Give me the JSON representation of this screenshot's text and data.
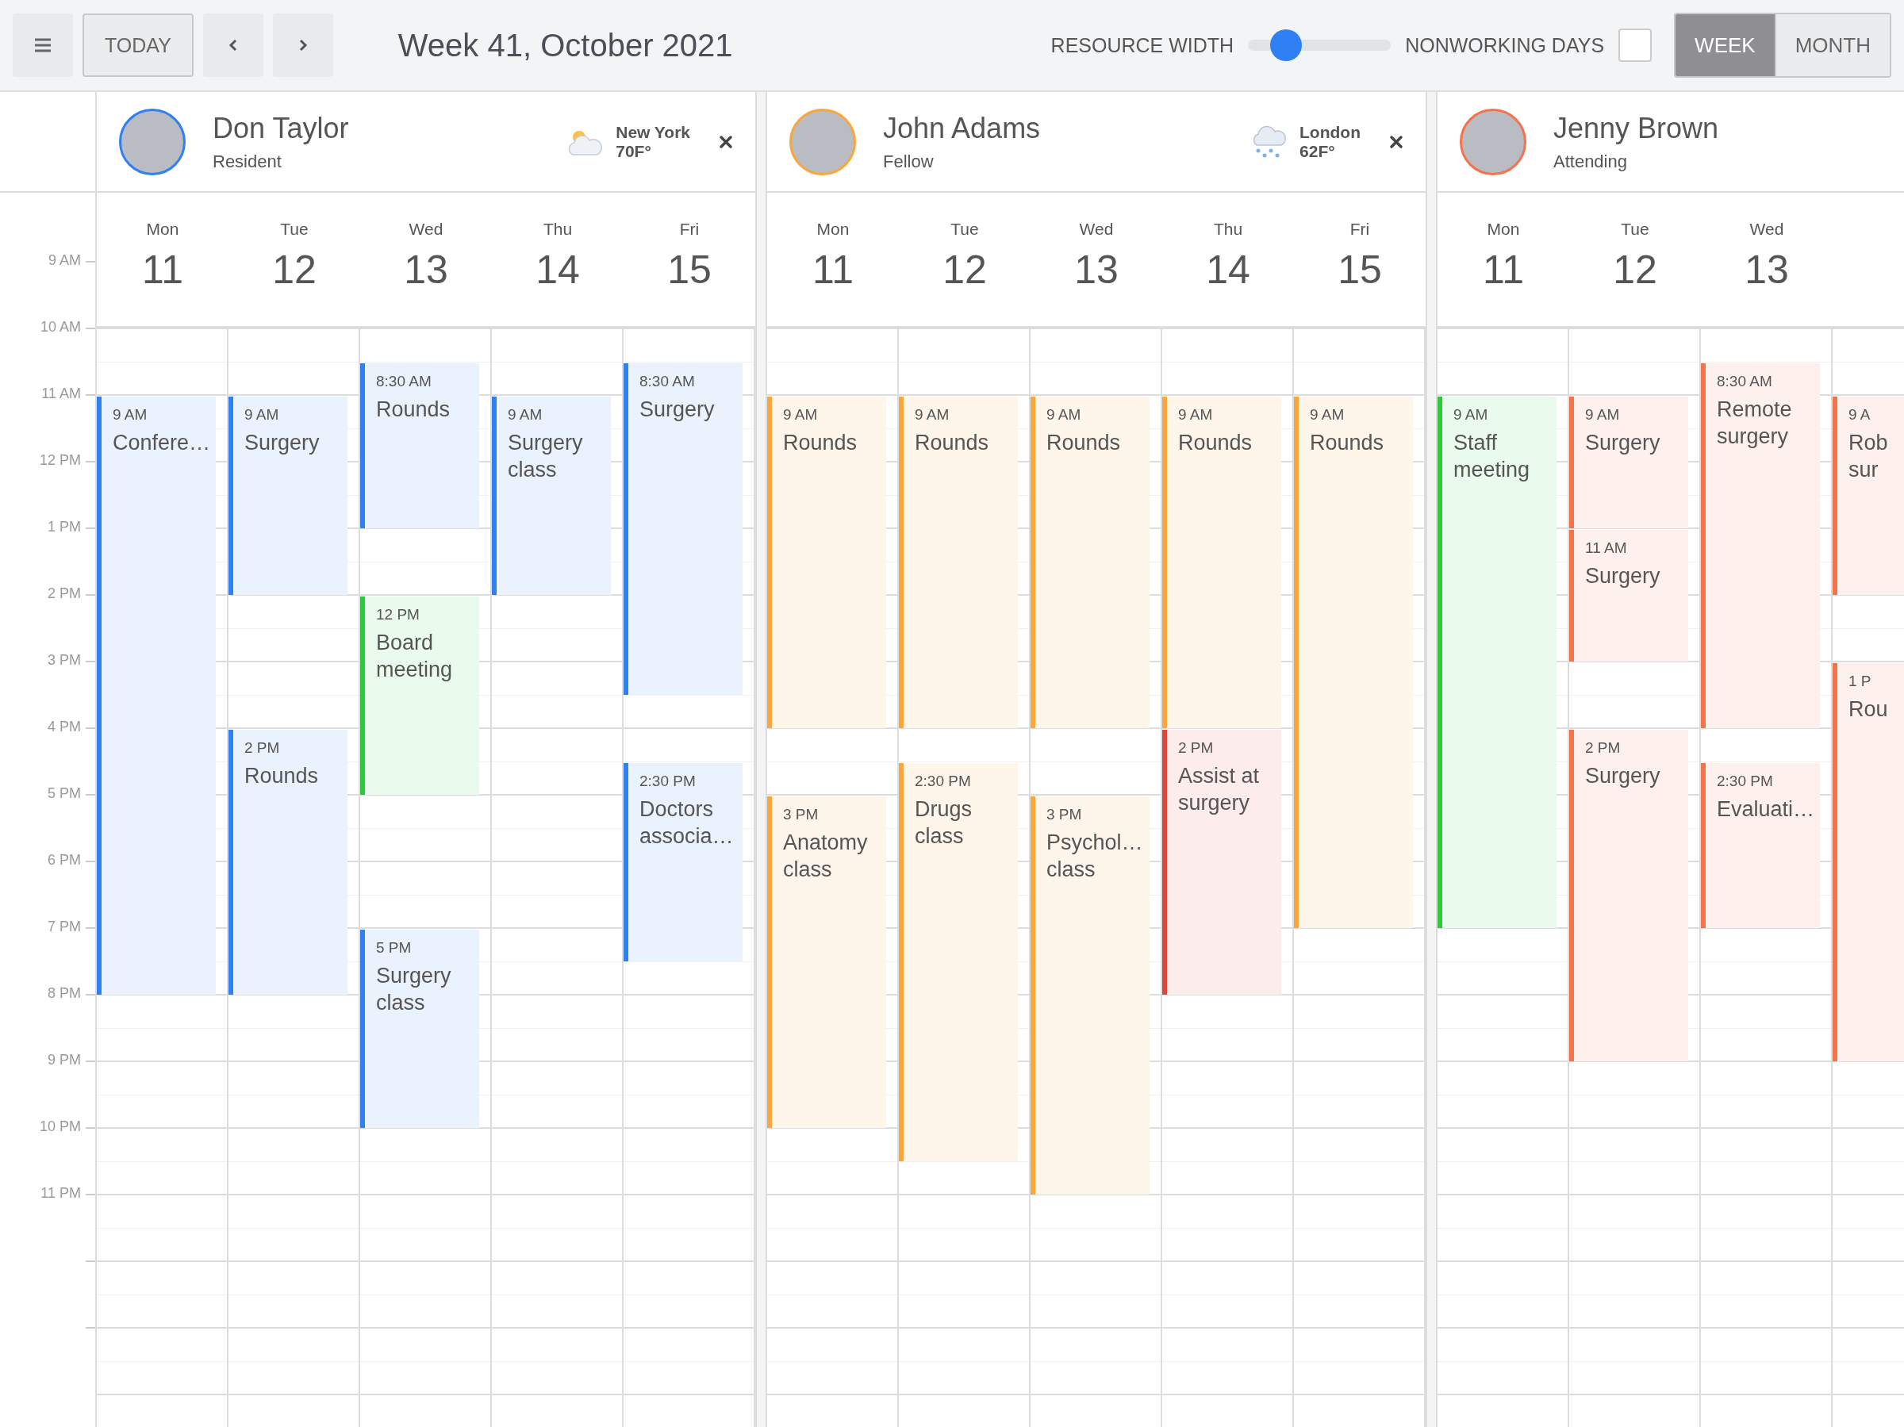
{
  "toolbar": {
    "today": "TODAY",
    "title": "Week 41, October 2021",
    "resource_width": {
      "label": "RESOURCE WIDTH",
      "level": 0.2
    },
    "nonworking_days": {
      "label": "NONWORKING DAYS",
      "checked": false
    },
    "views": [
      {
        "label": "WEEK",
        "selected": true
      },
      {
        "label": "MONTH",
        "selected": false
      }
    ]
  },
  "time_labels": [
    "9 AM",
    "10 AM",
    "11 AM",
    "12 PM",
    "1 PM",
    "2 PM",
    "3 PM",
    "4 PM",
    "5 PM",
    "6 PM",
    "7 PM",
    "8 PM",
    "9 PM",
    "10 PM",
    "11 PM"
  ],
  "resources": [
    {
      "name": "Don Taylor",
      "role": "Resident",
      "color": "#2f7ff5",
      "weather": {
        "kind": "partly-cloudy",
        "city": "New York",
        "temperature": "70F°"
      },
      "days": [
        {
          "name": "Mon",
          "number": "11",
          "events": [
            {
              "time": "9 AM",
              "title": "Confere…",
              "color": "#2f7ff5"
            }
          ]
        },
        {
          "name": "Tue",
          "number": "12",
          "events": [
            {
              "time": "9 AM",
              "title": "Surgery",
              "color": "#2f7ff5"
            },
            {
              "time": "2 PM",
              "title": "Rounds",
              "color": "#2f7ff5"
            }
          ]
        },
        {
          "name": "Wed",
          "number": "13",
          "events": [
            {
              "time": "8:30 AM",
              "title": "Rounds",
              "color": "#2f7ff5"
            },
            {
              "time": "12 PM",
              "title": "Board meeting",
              "color": "#2ec83e"
            },
            {
              "time": "5 PM",
              "title": "Surgery class",
              "color": "#2f7ff5"
            }
          ]
        },
        {
          "name": "Thu",
          "number": "14",
          "events": [
            {
              "time": "9 AM",
              "title": "Surgery class",
              "color": "#2f7ff5"
            }
          ]
        },
        {
          "name": "Fri",
          "number": "15",
          "events": [
            {
              "time": "8:30 AM",
              "title": "Surgery",
              "color": "#2f7ff5"
            },
            {
              "time": "2:30 PM",
              "title": "Doctors associa…",
              "color": "#2f7ff5"
            }
          ]
        }
      ]
    },
    {
      "name": "John Adams",
      "role": "Fellow",
      "color": "#f9a63a",
      "weather": {
        "kind": "snow",
        "city": "London",
        "temperature": "62F°"
      },
      "days": [
        {
          "name": "Mon",
          "number": "11",
          "events": [
            {
              "time": "9 AM",
              "title": "Rounds",
              "color": "#f9a63a"
            },
            {
              "time": "3 PM",
              "title": "Anatomy class",
              "color": "#f9a63a"
            }
          ]
        },
        {
          "name": "Tue",
          "number": "12",
          "events": [
            {
              "time": "9 AM",
              "title": "Rounds",
              "color": "#f9a63a"
            },
            {
              "time": "2:30 PM",
              "title": "Drugs class",
              "color": "#f9a63a"
            }
          ]
        },
        {
          "name": "Wed",
          "number": "13",
          "events": [
            {
              "time": "9 AM",
              "title": "Rounds",
              "color": "#f9a63a"
            },
            {
              "time": "3 PM",
              "title": "Psychol… class",
              "color": "#f9a63a"
            }
          ]
        },
        {
          "name": "Thu",
          "number": "14",
          "events": [
            {
              "time": "9 AM",
              "title": "Rounds",
              "color": "#f9a63a"
            },
            {
              "time": "2 PM",
              "title": "Assist at surgery",
              "color": "#e0453a"
            }
          ]
        },
        {
          "name": "Fri",
          "number": "15",
          "events": [
            {
              "time": "9 AM",
              "title": "Rounds",
              "color": "#f9a63a"
            }
          ]
        }
      ]
    },
    {
      "name": "Jenny Brown",
      "role": "Attending",
      "color": "#f4734a",
      "days": [
        {
          "name": "Mon",
          "number": "11",
          "events": [
            {
              "time": "9 AM",
              "title": "Staff meeting",
              "color": "#2ec83e"
            }
          ]
        },
        {
          "name": "Tue",
          "number": "12",
          "events": [
            {
              "time": "9 AM",
              "title": "Surgery",
              "color": "#f4734a"
            },
            {
              "time": "11 AM",
              "title": "Surgery",
              "color": "#f4734a"
            },
            {
              "time": "2 PM",
              "title": "Surgery",
              "color": "#f4734a"
            }
          ]
        },
        {
          "name": "Wed",
          "number": "13",
          "events": [
            {
              "time": "8:30 AM",
              "title": "Remote surgery",
              "color": "#f4734a"
            },
            {
              "time": "2:30 PM",
              "title": "Evaluati…",
              "color": "#f4734a"
            }
          ]
        },
        {
          "events": [
            {
              "time": "9 A",
              "title": "Rob sur",
              "color": "#f4734a"
            },
            {
              "time": "1 P",
              "title": "Rou",
              "color": "#f4734a"
            }
          ]
        }
      ]
    }
  ]
}
